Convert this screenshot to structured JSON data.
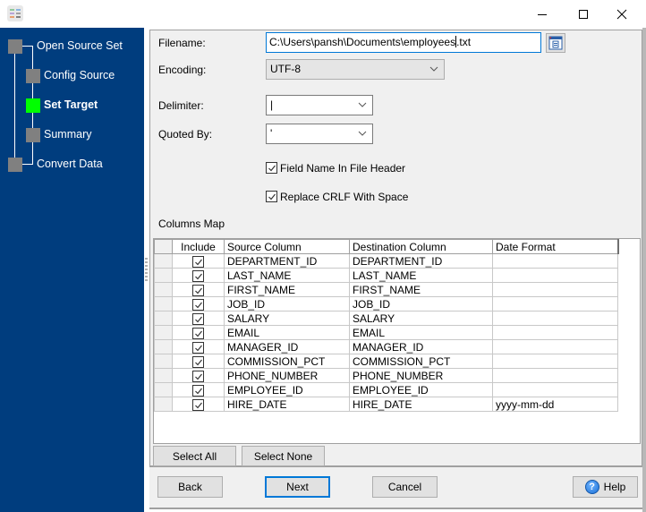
{
  "window": {
    "controls": {
      "minimize": "minimize-icon",
      "maximize": "maximize-icon",
      "close": "close-icon"
    }
  },
  "sidebar": {
    "steps": [
      {
        "label": "Open Source Set",
        "state": "pending"
      },
      {
        "label": "Config Source",
        "state": "pending"
      },
      {
        "label": "Set Target",
        "state": "active"
      },
      {
        "label": "Summary",
        "state": "pending"
      },
      {
        "label": "Convert Data",
        "state": "pending"
      }
    ],
    "colors": {
      "background": "#003d7e",
      "active": "#00ff00",
      "pending": "#808080"
    }
  },
  "form": {
    "filename_label": "Filename:",
    "filename_value_before_caret": "C:\\Users\\pansh\\Documents\\employees",
    "filename_value_after_caret": ".txt",
    "encoding_label": "Encoding:",
    "encoding_value": "UTF-8",
    "delimiter_label": "Delimiter:",
    "delimiter_value": "|",
    "quoted_by_label": "Quoted By:",
    "quoted_by_value": "'",
    "field_name_header_label": "Field Name In File Header",
    "field_name_header_checked": true,
    "replace_crlf_label": "Replace CRLF With Space",
    "replace_crlf_checked": true
  },
  "columns_map": {
    "title": "Columns Map",
    "headers": [
      "Include",
      "Source Column",
      "Destination Column",
      "Date Format"
    ],
    "rows": [
      {
        "include": true,
        "source": "DEPARTMENT_ID",
        "destination": "DEPARTMENT_ID",
        "date_format": ""
      },
      {
        "include": true,
        "source": "LAST_NAME",
        "destination": "LAST_NAME",
        "date_format": ""
      },
      {
        "include": true,
        "source": "FIRST_NAME",
        "destination": "FIRST_NAME",
        "date_format": ""
      },
      {
        "include": true,
        "source": "JOB_ID",
        "destination": "JOB_ID",
        "date_format": ""
      },
      {
        "include": true,
        "source": "SALARY",
        "destination": "SALARY",
        "date_format": ""
      },
      {
        "include": true,
        "source": "EMAIL",
        "destination": "EMAIL",
        "date_format": ""
      },
      {
        "include": true,
        "source": "MANAGER_ID",
        "destination": "MANAGER_ID",
        "date_format": ""
      },
      {
        "include": true,
        "source": "COMMISSION_PCT",
        "destination": "COMMISSION_PCT",
        "date_format": ""
      },
      {
        "include": true,
        "source": "PHONE_NUMBER",
        "destination": "PHONE_NUMBER",
        "date_format": ""
      },
      {
        "include": true,
        "source": "EMPLOYEE_ID",
        "destination": "EMPLOYEE_ID",
        "date_format": ""
      },
      {
        "include": true,
        "source": "HIRE_DATE",
        "destination": "HIRE_DATE",
        "date_format": "yyyy-mm-dd"
      }
    ],
    "select_all_label": "Select All",
    "select_none_label": "Select None"
  },
  "footer": {
    "back_label": "Back",
    "next_label": "Next",
    "cancel_label": "Cancel",
    "help_label": "Help",
    "help_icon_glyph": "?"
  }
}
